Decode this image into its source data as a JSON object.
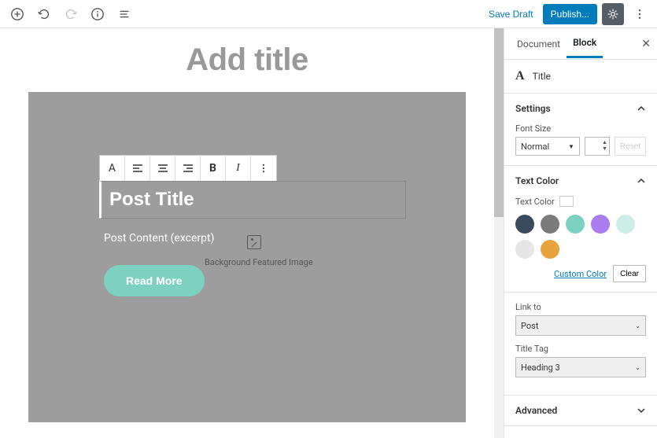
{
  "topbar": {
    "save_draft": "Save Draft",
    "publish": "Publish..."
  },
  "editor": {
    "title_placeholder": "Add title",
    "post_title": "Post Title",
    "post_content": "Post Content (excerpt)",
    "featured_image_label": "Background Featured Image",
    "read_more": "Read More",
    "toolbar": {
      "text_tool": "A",
      "bold": "B",
      "italic": "I"
    }
  },
  "sidebar": {
    "tabs": {
      "document": "Document",
      "block": "Block"
    },
    "block_type": {
      "icon": "A",
      "label": "Title"
    },
    "settings": {
      "heading": "Settings",
      "font_size_label": "Font Size",
      "font_size_value": "Normal",
      "reset": "Reset"
    },
    "text_color": {
      "heading": "Text Color",
      "label": "Text Color",
      "swatches": [
        "#3a4b5c",
        "#7b7b7b",
        "#7dd1c1",
        "#a97df0",
        "#cdeee8",
        "#e6e6e6",
        "#e8a33d"
      ],
      "custom": "Custom Color",
      "clear": "Clear"
    },
    "link_to": {
      "label": "Link to",
      "value": "Post"
    },
    "title_tag": {
      "label": "Title Tag",
      "value": "Heading 3"
    },
    "advanced": {
      "heading": "Advanced"
    }
  }
}
